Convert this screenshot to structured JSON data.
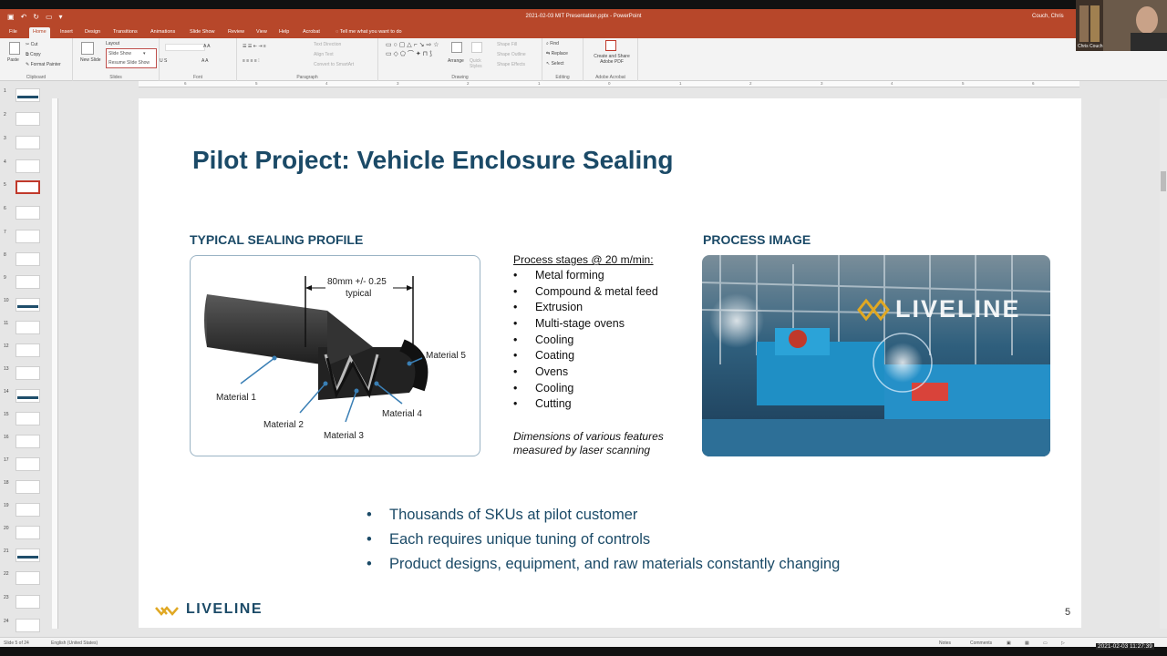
{
  "window": {
    "doc_title": "2021-02-03 MIT Presentation.pptx  -  PowerPoint",
    "user": "Couch, Chris",
    "search_hint": "Tell me what you want to do"
  },
  "tabs": [
    "File",
    "Home",
    "Insert",
    "Design",
    "Transitions",
    "Animations",
    "Slide Show",
    "Review",
    "View",
    "Help",
    "Acrobat"
  ],
  "ribbon": {
    "clipboard": {
      "paste": "Paste",
      "cut": "Cut",
      "copy": "Copy",
      "format_painter": "Format Painter",
      "label": "Clipboard"
    },
    "slides": {
      "new_slide": "New Slide",
      "layout": "Layout",
      "slide_show": "Slide Show",
      "resume": "Resume Slide Show",
      "label": "Slides"
    },
    "font_label": "Font",
    "paragraph": {
      "text_direction": "Text Direction",
      "align_text": "Align Text",
      "smartart": "Convert to SmartArt",
      "label": "Paragraph"
    },
    "drawing": {
      "arrange": "Arrange",
      "quick_styles": "Quick Styles",
      "shape_fill": "Shape Fill",
      "shape_outline": "Shape Outline",
      "shape_effects": "Shape Effects",
      "label": "Drawing"
    },
    "editing": {
      "find": "Find",
      "replace": "Replace",
      "select": "Select",
      "label": "Editing"
    },
    "adobe": {
      "create": "Create and Share Adobe PDF",
      "label": "Adobe Acrobat"
    }
  },
  "ruler_ticks": [
    "6",
    "5",
    "4",
    "3",
    "2",
    "1",
    "0",
    "1",
    "2",
    "3",
    "4",
    "5",
    "6"
  ],
  "thumbnails": [
    "1",
    "2",
    "3",
    "4",
    "5",
    "6",
    "7",
    "8",
    "9",
    "10",
    "11",
    "12",
    "13",
    "14",
    "15",
    "16",
    "17",
    "18",
    "19",
    "20",
    "21",
    "22",
    "23",
    "24"
  ],
  "slide": {
    "title": "Pilot Project: Vehicle Enclosure Sealing",
    "profile_heading": "TYPICAL SEALING PROFILE",
    "profile_dim": "80mm +/- 0.25",
    "profile_dim2": "typical",
    "materials": [
      "Material 1",
      "Material 2",
      "Material 3",
      "Material 4",
      "Material 5"
    ],
    "stages_heading": "Process stages @ 20 m/min:",
    "stages": [
      "Metal forming",
      "Compound & metal feed",
      "Extrusion",
      "Multi-stage ovens",
      "Cooling",
      "Coating",
      "Ovens",
      "Cooling",
      "Cutting"
    ],
    "dimensions_note": "Dimensions of various features measured by laser scanning",
    "process_heading": "PROCESS IMAGE",
    "process_logo": "LIVELINE",
    "bullets": [
      "Thousands of SKUs at pilot customer",
      "Each requires unique tuning of controls",
      "Product designs, equipment, and raw materials constantly changing"
    ],
    "logo": "LIVELINE",
    "page_number": "5"
  },
  "status": {
    "slide_of": "Slide 5 of 24",
    "language": "English (United States)",
    "notes": "Notes",
    "comments": "Comments"
  },
  "clock": "2021-02-03  11:27:39",
  "webcam_name": "Chris Couch",
  "colors": {
    "accent": "#b7472a",
    "title": "#1b4a67",
    "logo_gold": "#e0a823"
  }
}
